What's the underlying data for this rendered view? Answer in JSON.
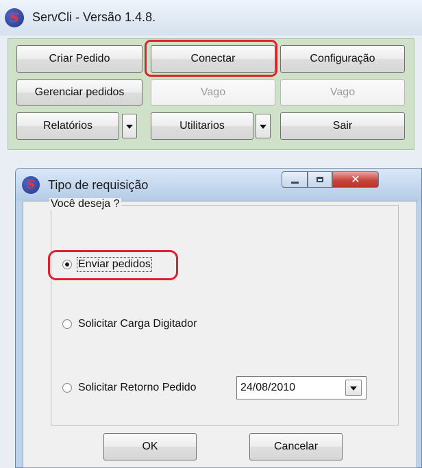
{
  "window": {
    "title": "ServCli - Versão 1.4.8.",
    "icon": "servcli-logo-icon"
  },
  "toolbar": {
    "criar_pedido": "Criar Pedido",
    "conectar": "Conectar",
    "configuracao": "Configuração",
    "gerenciar_pedidos": "Gerenciar pedidos",
    "vago_1": "Vago",
    "vago_2": "Vago",
    "relatorios": "Relatórios",
    "utilitarios": "Utilitarios",
    "sair": "Sair"
  },
  "dialog": {
    "title": "Tipo de requisição",
    "group_label": "Você deseja ?",
    "options": [
      {
        "label": "Enviar pedidos",
        "selected": true
      },
      {
        "label": "Solicitar Carga Digitador",
        "selected": false
      },
      {
        "label": "Solicitar Retorno Pedido",
        "selected": false
      }
    ],
    "date_value": "24/08/2010",
    "ok_label": "OK",
    "cancel_label": "Cancelar"
  },
  "colors": {
    "highlight": "#e0202a",
    "button_panel_bg": "#cfe2c9",
    "dialog_frame": "#bcd3ec",
    "close_button": "#c9463d"
  }
}
